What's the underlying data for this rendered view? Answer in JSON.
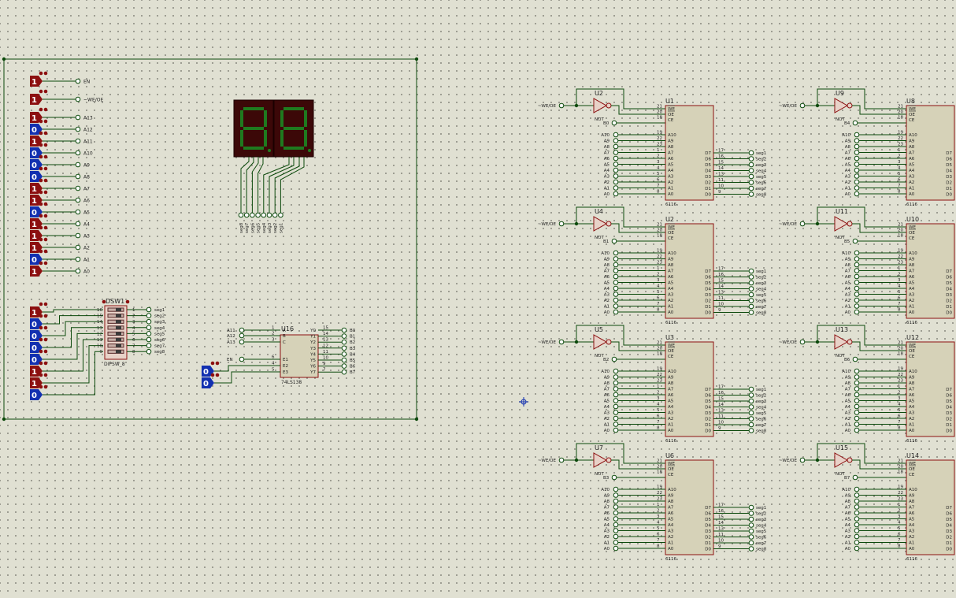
{
  "left": {
    "control_inputs": [
      {
        "value": "1",
        "net": "EN"
      },
      {
        "value": "1",
        "net": "~WE/OE"
      }
    ],
    "address_inputs": [
      {
        "value": "1",
        "net": "A13"
      },
      {
        "value": "0",
        "net": "A12"
      },
      {
        "value": "1",
        "net": "A11"
      },
      {
        "value": "0",
        "net": "A10"
      },
      {
        "value": "0",
        "net": "A9"
      },
      {
        "value": "0",
        "net": "A8"
      },
      {
        "value": "1",
        "net": "A7"
      },
      {
        "value": "1",
        "net": "A6"
      },
      {
        "value": "0",
        "net": "A5"
      },
      {
        "value": "1",
        "net": "A4"
      },
      {
        "value": "1",
        "net": "A3"
      },
      {
        "value": "1",
        "net": "A2"
      },
      {
        "value": "0",
        "net": "A1"
      },
      {
        "value": "1",
        "net": "A0"
      }
    ],
    "dip_inputs": [
      "1",
      "0",
      "0",
      "0",
      "0",
      "1",
      "1",
      "0"
    ],
    "dipsw": {
      "ref": "DSW1",
      "type": "DIPSW_8",
      "left_pins": [
        "16",
        "15",
        "14",
        "13",
        "12",
        "11",
        "10",
        "9"
      ],
      "right_pins": [
        "1",
        "2",
        "3",
        "4",
        "5",
        "6",
        "7",
        "8"
      ],
      "outputs": [
        "seg1",
        "seg2",
        "seg3",
        "seg4",
        "seg5",
        "seg6",
        "seg7",
        "seg8"
      ]
    },
    "display": {
      "digits": [
        "8",
        "8"
      ],
      "pins": [
        "seg8",
        "seg7",
        "seg6",
        "seg5",
        "seg4",
        "seg3",
        "seg2",
        "seg1"
      ]
    },
    "decoder": {
      "ref": "U16",
      "type": "74LS138",
      "inputs": [
        {
          "net": "A11",
          "pin": "1",
          "name": "A"
        },
        {
          "net": "A12",
          "pin": "2",
          "name": "B"
        },
        {
          "net": "A13",
          "pin": "3",
          "name": "C"
        },
        {
          "net": "EN",
          "pin": "6",
          "name": "E1"
        },
        {
          "net": "",
          "pin": "4",
          "name": "E2"
        },
        {
          "net": "",
          "pin": "5",
          "name": "E3"
        }
      ],
      "outputs": [
        {
          "name": "Y0",
          "pin": "15",
          "net": "B0"
        },
        {
          "name": "Y1",
          "pin": "14",
          "net": "B1"
        },
        {
          "name": "Y2",
          "pin": "13",
          "net": "B2"
        },
        {
          "name": "Y3",
          "pin": "12",
          "net": "B3"
        },
        {
          "name": "Y4",
          "pin": "11",
          "net": "B4"
        },
        {
          "name": "Y5",
          "pin": "10",
          "net": "B5"
        },
        {
          "name": "Y6",
          "pin": "9",
          "net": "B6"
        },
        {
          "name": "Y7",
          "pin": "7",
          "net": "B7"
        }
      ],
      "enable_inputs": [
        "0",
        "0"
      ]
    }
  },
  "memory": {
    "we_label": "~WE/OE",
    "not_label": "NOT",
    "chip_type": "6116",
    "ctrl_pins": [
      {
        "pin": "21",
        "name": "WE"
      },
      {
        "pin": "20",
        "name": "OE"
      },
      {
        "pin": "18",
        "name": "CE"
      }
    ],
    "addr_pins": [
      {
        "net": "A10",
        "pin": "19",
        "name": "A10"
      },
      {
        "net": "A9",
        "pin": "22",
        "name": "A9"
      },
      {
        "net": "A8",
        "pin": "23",
        "name": "A8"
      },
      {
        "net": "A7",
        "pin": "1",
        "name": "A7"
      },
      {
        "net": "A6",
        "pin": "2",
        "name": "A6"
      },
      {
        "net": "A5",
        "pin": "3",
        "name": "A5"
      },
      {
        "net": "A4",
        "pin": "4",
        "name": "A4"
      },
      {
        "net": "A3",
        "pin": "5",
        "name": "A3"
      },
      {
        "net": "A2",
        "pin": "6",
        "name": "A2"
      },
      {
        "net": "A1",
        "pin": "7",
        "name": "A1"
      },
      {
        "net": "A0",
        "pin": "8",
        "name": "A0"
      }
    ],
    "data_pins": [
      {
        "name": "D7",
        "pin": "17",
        "net": "seg1"
      },
      {
        "name": "D6",
        "pin": "16",
        "net": "seg2"
      },
      {
        "name": "D5",
        "pin": "15",
        "net": "seg3"
      },
      {
        "name": "D4",
        "pin": "14",
        "net": "seg4"
      },
      {
        "name": "D3",
        "pin": "13",
        "net": "seg5"
      },
      {
        "name": "D2",
        "pin": "11",
        "net": "seg6"
      },
      {
        "name": "D1",
        "pin": "10",
        "net": "seg7"
      },
      {
        "name": "D0",
        "pin": "9",
        "net": "seg8"
      }
    ],
    "blocks": [
      {
        "not_ref": "U2",
        "ram_ref": "U1",
        "cs": "B0"
      },
      {
        "not_ref": "U4",
        "ram_ref": "U2",
        "cs": "B1"
      },
      {
        "not_ref": "U5",
        "ram_ref": "U3",
        "cs": "B2"
      },
      {
        "not_ref": "U7",
        "ram_ref": "U6",
        "cs": "B3"
      },
      {
        "not_ref": "U9",
        "ram_ref": "U8",
        "cs": "B4"
      },
      {
        "not_ref": "U11",
        "ram_ref": "U10",
        "cs": "B5"
      },
      {
        "not_ref": "U13",
        "ram_ref": "U12",
        "cs": "B6"
      },
      {
        "not_ref": "U15",
        "ram_ref": "U14",
        "cs": "B7"
      }
    ]
  }
}
